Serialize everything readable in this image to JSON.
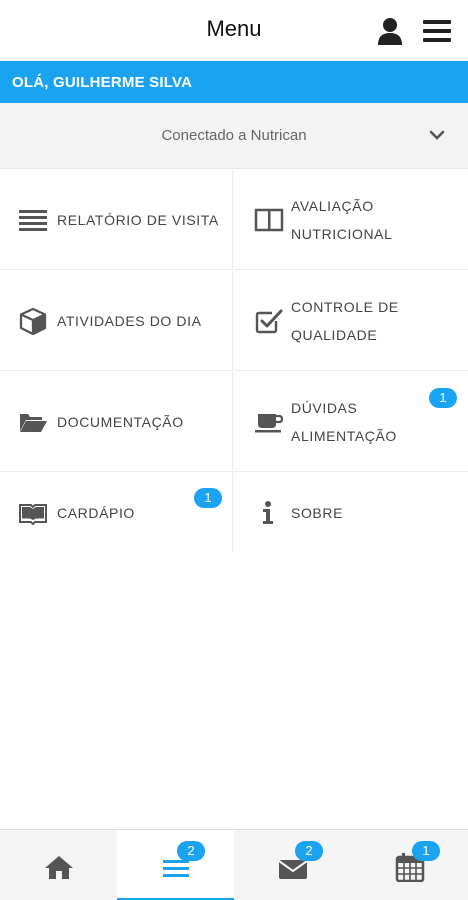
{
  "header": {
    "title": "Menu",
    "user_icon": "user-icon",
    "menu_icon": "hamburger-icon"
  },
  "greeting": {
    "text": "OLÁ, GUILHERME SILVA"
  },
  "connection": {
    "text": "Conectado a Nutrican",
    "icon": "chevron-down-icon"
  },
  "menu": {
    "items": [
      {
        "label": "RELATÓRIO DE VISITA",
        "icon": "list-icon"
      },
      {
        "label": "AVALIAÇÃO\nNUTRICIONAL",
        "icon": "columns-icon"
      },
      {
        "label": "ATIVIDADES DO DIA",
        "icon": "cube-icon"
      },
      {
        "label": "CONTROLE DE\nQUALIDADE",
        "icon": "checkbox-icon"
      },
      {
        "label": "DOCUMENTAÇÃO",
        "icon": "folder-open-icon"
      },
      {
        "label": "DÚVIDAS\nALIMENTAÇÃO",
        "icon": "coffee-cup-icon",
        "badge": "1"
      },
      {
        "label": "CARDÁPIO",
        "icon": "open-book-icon",
        "badge": "1"
      },
      {
        "label": "SOBRE",
        "icon": "info-icon"
      }
    ]
  },
  "bottom_nav": {
    "items": [
      {
        "name": "home",
        "icon": "home-icon"
      },
      {
        "name": "menu",
        "icon": "hamburger-icon",
        "badge": "2",
        "active": true
      },
      {
        "name": "messages",
        "icon": "envelope-icon",
        "badge": "2"
      },
      {
        "name": "calendar",
        "icon": "calendar-icon",
        "badge": "1"
      }
    ]
  },
  "colors": {
    "accent": "#1aa3f1",
    "icon_gray": "#555555",
    "text": "#444444"
  }
}
